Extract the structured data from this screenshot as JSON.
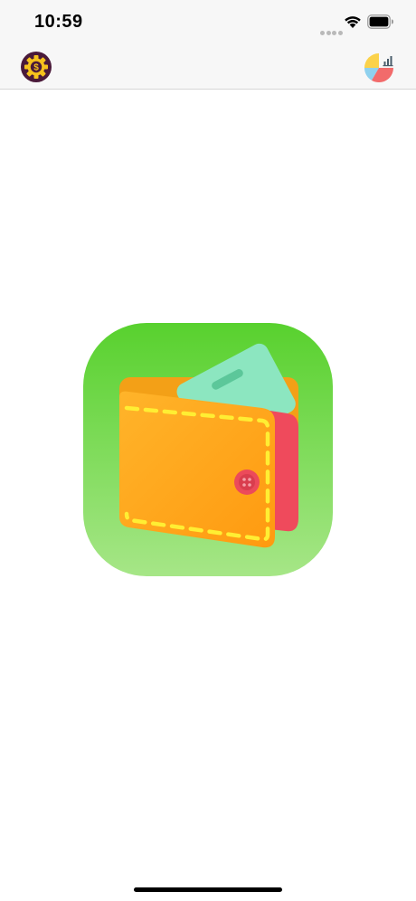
{
  "status_bar": {
    "time": "10:59",
    "icons": [
      "cellular-signal-icon",
      "wifi-icon",
      "battery-icon"
    ]
  },
  "nav_bar": {
    "left_button": {
      "icon": "money-settings-icon"
    },
    "right_button": {
      "icon": "pie-chart-stats-icon"
    }
  },
  "app_logo": {
    "icon": "wallet-icon",
    "colors": {
      "background_top": "#58d12e",
      "background_bottom": "#a6e687",
      "wallet_body": "#ffa91c",
      "stitching": "#ffee33",
      "card": "#8ce6c0",
      "inner_flap": "#f04a5c"
    }
  },
  "colors": {
    "bar_background": "#f7f7f7",
    "divider": "#d6d6d6",
    "page_background": "#ffffff"
  }
}
